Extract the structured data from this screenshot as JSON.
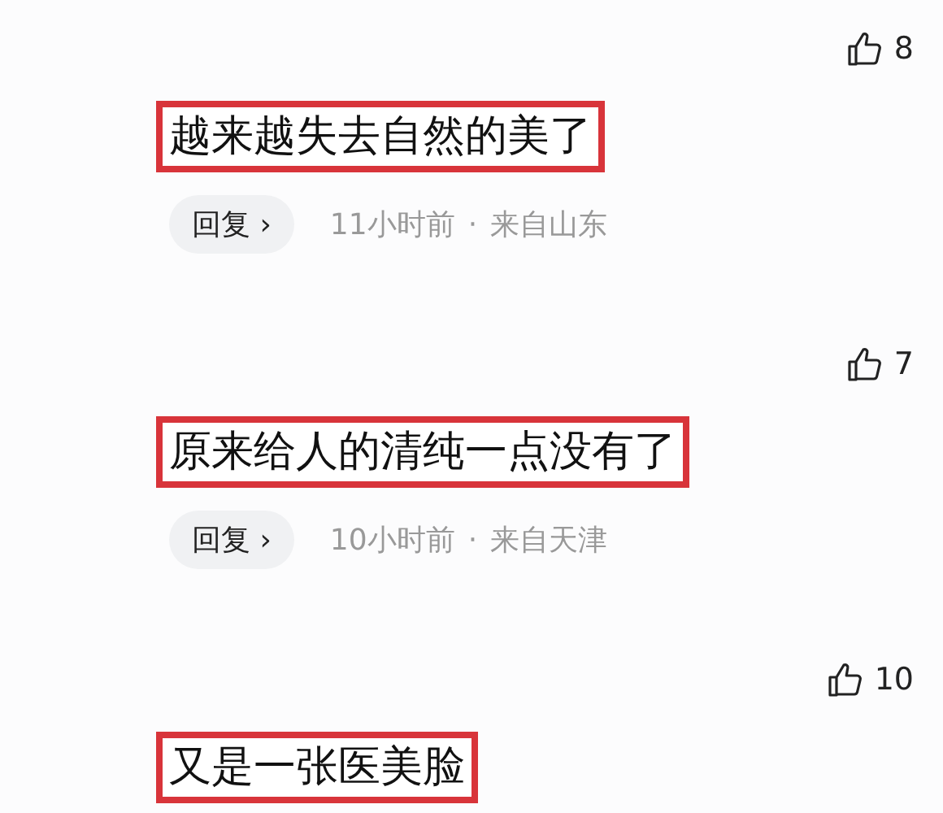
{
  "comments": [
    {
      "likes": "8",
      "text": "越来越失去自然的美了",
      "highlighted": true,
      "reply": {
        "label": "回复",
        "arrow": "›",
        "time": "11小时前",
        "separator": "·",
        "location": "来自山东"
      }
    },
    {
      "likes": "7",
      "text": "原来给人的清纯一点没有了",
      "highlighted": true,
      "reply": {
        "label": "回复",
        "arrow": "›",
        "time": "10小时前",
        "separator": "·",
        "location": "来自天津"
      }
    },
    {
      "likes": "10",
      "text": "又是一张医美脸",
      "highlighted": true
    }
  ]
}
